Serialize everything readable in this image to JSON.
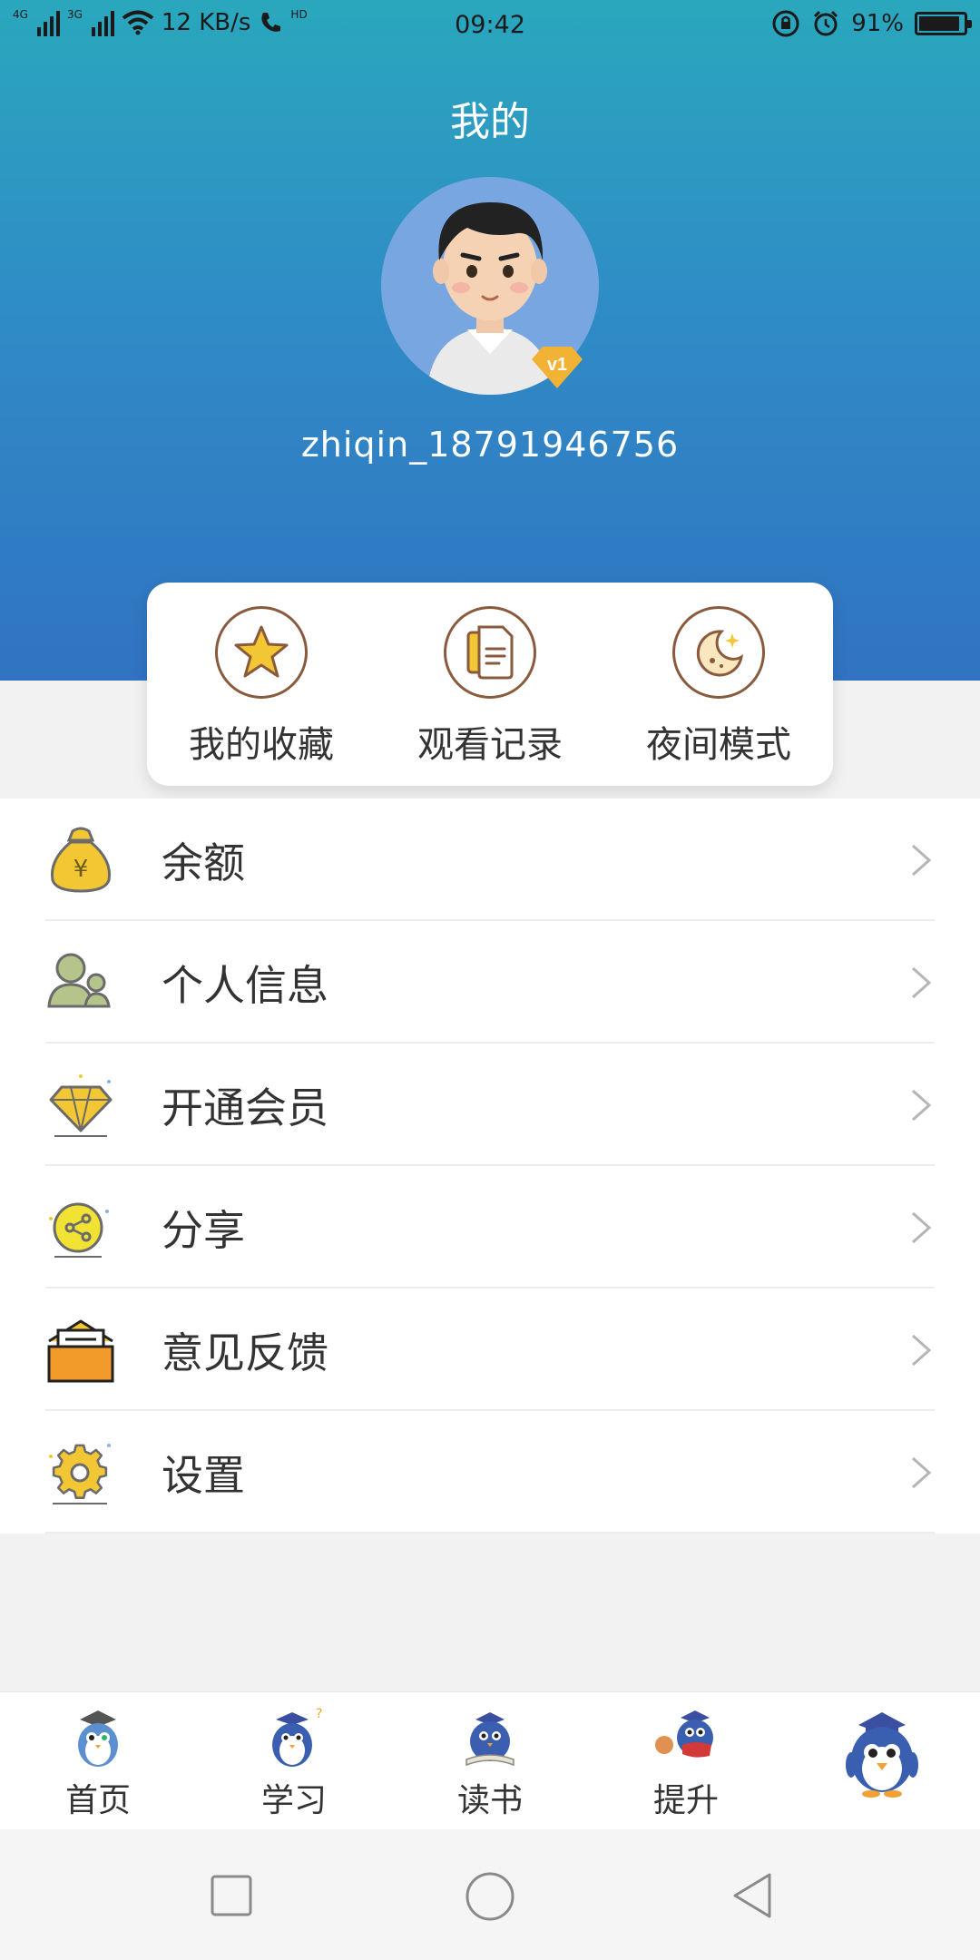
{
  "status_bar": {
    "net1": "4G",
    "net2": "3G",
    "speed": "12 KB/s",
    "hd": "HD",
    "time": "09:42",
    "battery": "91%",
    "battery_level": 0.91
  },
  "header": {
    "title": "我的",
    "username": "zhiqin_18791946756",
    "vip_level": "v1"
  },
  "quick_actions": [
    {
      "label": "我的收藏",
      "icon": "star-icon"
    },
    {
      "label": "观看记录",
      "icon": "history-document-icon"
    },
    {
      "label": "夜间模式",
      "icon": "night-moon-icon"
    }
  ],
  "menu": [
    {
      "label": "余额",
      "icon": "money-bag-icon"
    },
    {
      "label": "个人信息",
      "icon": "user-profile-icon"
    },
    {
      "label": "开通会员",
      "icon": "diamond-icon"
    },
    {
      "label": "分享",
      "icon": "share-icon"
    },
    {
      "label": "意见反馈",
      "icon": "feedback-envelope-icon"
    },
    {
      "label": "设置",
      "icon": "gear-icon"
    }
  ],
  "bottom_nav": [
    {
      "label": "首页",
      "icon": "home-penguin-icon"
    },
    {
      "label": "学习",
      "icon": "study-penguin-icon"
    },
    {
      "label": "读书",
      "icon": "reading-penguin-icon"
    },
    {
      "label": "提升",
      "icon": "improve-penguin-icon"
    },
    {
      "label": "",
      "icon": "profile-penguin-icon"
    }
  ],
  "colors": {
    "header_top": "#2aa7bd",
    "header_bottom": "#3173c2",
    "quick_icon_border": "#8a5a3c",
    "accent_yellow": "#f2c733"
  }
}
